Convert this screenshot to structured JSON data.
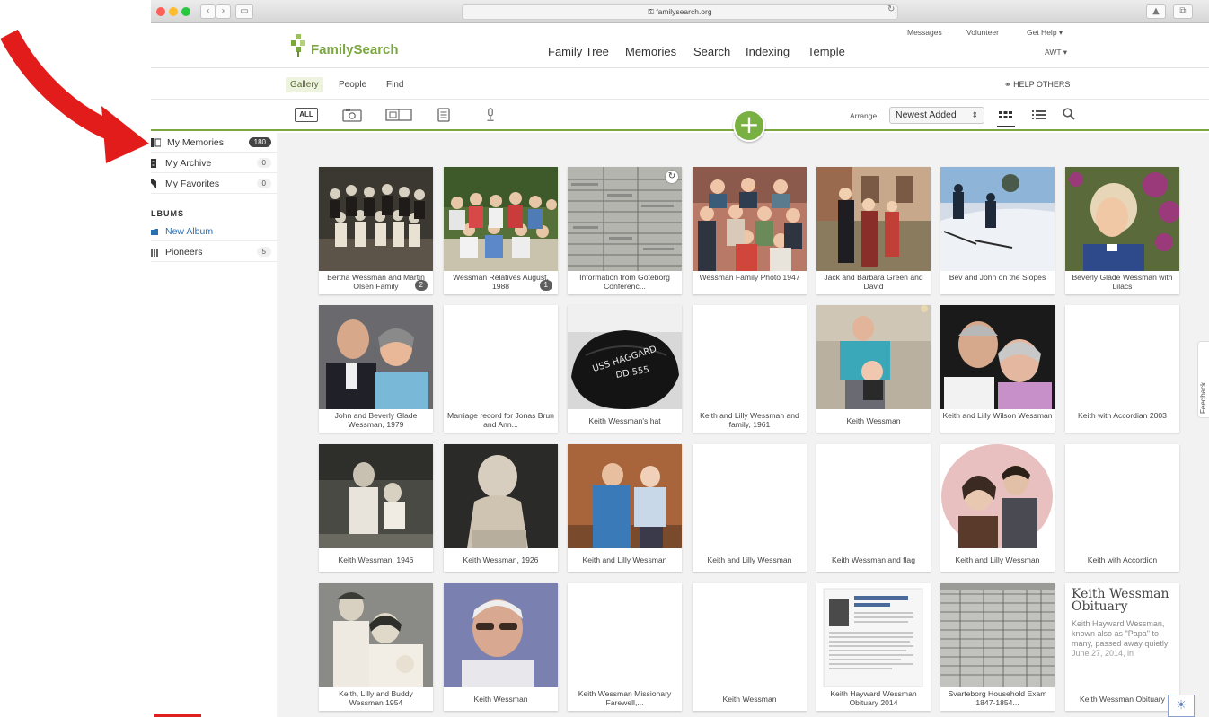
{
  "browser": {
    "url": "familysearch.org"
  },
  "site": {
    "logo_text": "FamilySearch",
    "nav": [
      "Family Tree",
      "Memories",
      "Search",
      "Indexing",
      "Temple"
    ],
    "util": {
      "messages": "Messages",
      "volunteer": "Volunteer",
      "get_help": "Get Help ▾",
      "user": "AWT ▾"
    }
  },
  "subnav": {
    "tabs": [
      {
        "label": "Gallery",
        "active": true
      },
      {
        "label": "People",
        "active": false
      },
      {
        "label": "Find",
        "active": false
      }
    ],
    "help_others": "HELP OTHERS"
  },
  "toolbar": {
    "all_label": "ALL",
    "arrange_label": "Arrange:",
    "arrange_value": "Newest Added",
    "add_label": "+"
  },
  "sidebar": {
    "items": [
      {
        "label": "My Memories",
        "count": "180"
      },
      {
        "label": "My Archive",
        "count": "0"
      },
      {
        "label": "My Favorites",
        "count": "0"
      }
    ],
    "albums_heading": "LBUMS",
    "albums": [
      {
        "label": "New Album"
      },
      {
        "label": "Pioneers",
        "count": "5"
      }
    ]
  },
  "gallery": {
    "rows": [
      [
        {
          "caption": "Bertha Wessman and Martin Olsen Family",
          "badge": "2"
        },
        {
          "caption": "Wessman Relatives August, 1988",
          "badge": "1"
        },
        {
          "caption": "Information from Goteborg Conferenc..."
        },
        {
          "caption": "Wessman Family Photo 1947"
        },
        {
          "caption": "Jack and Barbara Green and David"
        },
        {
          "caption": "Bev and John on the Slopes"
        },
        {
          "caption": "Beverly Glade Wessman with Lilacs"
        }
      ],
      [
        {
          "caption": "John and Beverly Glade Wessman, 1979"
        },
        {
          "caption": "Marriage record for Jonas Brun and Ann..."
        },
        {
          "caption": "Keith Wessman's hat"
        },
        {
          "caption": "Keith and Lilly Wessman and family, 1961"
        },
        {
          "caption": "Keith Wessman"
        },
        {
          "caption": "Keith and Lilly Wilson Wessman"
        },
        {
          "caption": "Keith with Accordian 2003"
        }
      ],
      [
        {
          "caption": "Keith Wessman, 1946"
        },
        {
          "caption": "Keith Wessman, 1926"
        },
        {
          "caption": "Keith and Lilly Wessman"
        },
        {
          "caption": "Keith and Lilly Wessman"
        },
        {
          "caption": "Keith Wessman and flag"
        },
        {
          "caption": "Keith and Lilly Wessman"
        },
        {
          "caption": "Keith with Accordion"
        }
      ],
      [
        {
          "caption": "Keith, Lilly and Buddy Wessman 1954"
        },
        {
          "caption": "Keith Wessman"
        },
        {
          "caption": "Keith Wessman Missionary Farewell,..."
        },
        {
          "caption": "Keith Wessman"
        },
        {
          "caption": "Keith Hayward Wessman Obituary 2014"
        },
        {
          "caption": "Svarteborg Household Exam 1847-1854..."
        },
        {
          "caption": "Keith Wessman Obituary"
        }
      ]
    ],
    "hat_text_1": "USS HAGGARD",
    "hat_text_2": "DD 555",
    "obituary_preview": {
      "title": "Keith Wessman Obituary",
      "body": "Keith Hayward Wessman, known also as \"Papa\" to many, passed away quietly June 27, 2014, in"
    }
  },
  "feedback_label": "Feedback"
}
